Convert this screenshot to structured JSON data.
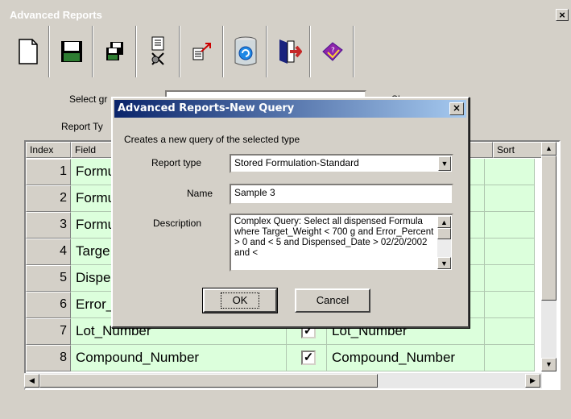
{
  "window": {
    "title": "Advanced Reports",
    "close": "×"
  },
  "toolbar": {
    "buttons": [
      {
        "icon": "new-document-icon"
      },
      {
        "icon": "save-disk-icon"
      },
      {
        "icon": "save-all-icon"
      },
      {
        "icon": "run-query-icon"
      },
      {
        "icon": "export-icon"
      },
      {
        "icon": "database-icon"
      },
      {
        "icon": "exit-door-icon"
      },
      {
        "icon": "help-book-icon"
      }
    ]
  },
  "behind": {
    "select_label": "Select gr",
    "report_type_label": "Report Ty",
    "checkbox_hint": "Sh"
  },
  "grid": {
    "headers": {
      "index": "Index",
      "field": "Field",
      "sort": "Sort"
    },
    "rows": [
      {
        "index": "1",
        "field": "Formu",
        "right": "",
        "checked": false
      },
      {
        "index": "2",
        "field": "Formu",
        "right": "",
        "checked": false
      },
      {
        "index": "3",
        "field": "Formu",
        "right": "",
        "checked": false
      },
      {
        "index": "4",
        "field": "Targe",
        "right": "",
        "checked": false
      },
      {
        "index": "5",
        "field": "Dispe",
        "right": "",
        "checked": false
      },
      {
        "index": "6",
        "field": "Error_",
        "right": "",
        "checked": false
      },
      {
        "index": "7",
        "field": "Lot_Number",
        "right": "Lot_Number",
        "checked": true
      },
      {
        "index": "8",
        "field": "Compound_Number",
        "right": "Compound_Number",
        "checked": true
      }
    ]
  },
  "dialog": {
    "title": "Advanced Reports-New Query",
    "close": "×",
    "subtitle": "Creates a new query of the selected type",
    "report_type_label": "Report type",
    "report_type_value": "Stored Formulation-Standard",
    "name_label": "Name",
    "name_value": "Sample 3",
    "description_label": "Description",
    "description_value": "Complex Query: Select all dispensed Formula  where Target_Weight < 700 g and Error_Percent > 0 and < 5 and Dispensed_Date > 02/20/2002 and <",
    "ok_label": "OK",
    "cancel_label": "Cancel"
  },
  "check_mark": "✓"
}
